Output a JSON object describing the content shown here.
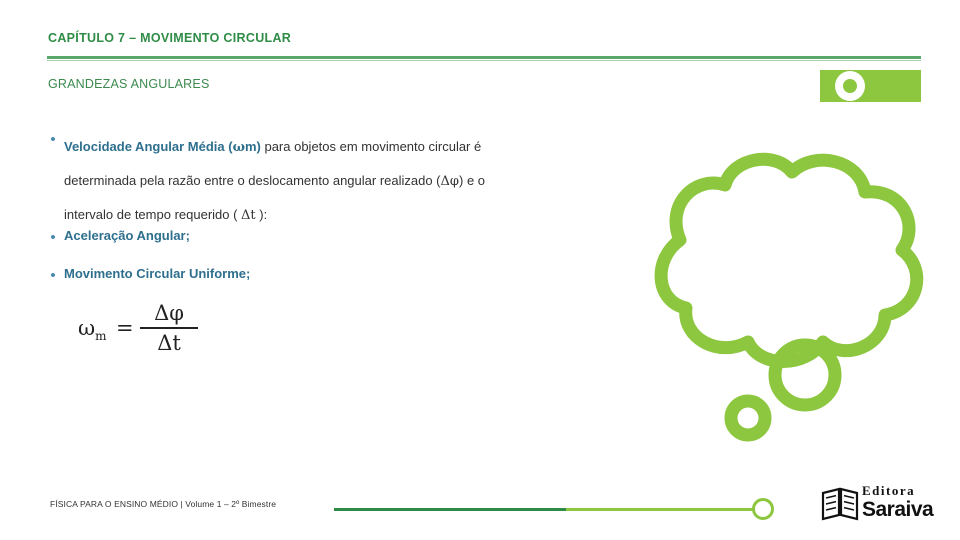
{
  "header": {
    "chapter_title": "CAPÍTULO 7 – MOVIMENTO CIRCULAR",
    "subtitle": "GRANDEZAS ANGULARES"
  },
  "bullets": [
    {
      "marker": "•",
      "highlight": "Velocidade Angular Média (",
      "symbol_omega": "ω",
      "symbol_sub": "m",
      "highlight_end": ")",
      "rest_line1": " para objetos em movimento circular é",
      "line2_a": "determinada pela razão entre o deslocamento angular realizado (",
      "line2_sym": "Δφ",
      "line2_b": ") e o",
      "line3_a": "intervalo de tempo requerido ( ",
      "line3_sym": "Δt",
      "line3_b": " ):"
    },
    {
      "marker": "•",
      "text": "Aceleração Angular;"
    },
    {
      "marker": "•",
      "text": "Movimento Circular Uniforme;"
    }
  ],
  "formula": {
    "lhs": "ω",
    "lhs_sub": "m",
    "equals": "=",
    "numerator": "Δφ",
    "denominator": "Δt"
  },
  "footer": {
    "text": "FÍSICA PARA O ENSINO MÉDIO  | Volume 1 – 2º Bimestre",
    "logo_line1": "Editora",
    "logo_line2": "Saraiva"
  },
  "colors": {
    "accent_dark_green": "#2f8c46",
    "accent_light_green": "#8dc63f",
    "bullet_blue": "#2e6f8e",
    "body_text": "#333333"
  },
  "decor": {
    "cloud": "thought-cloud-shape"
  }
}
